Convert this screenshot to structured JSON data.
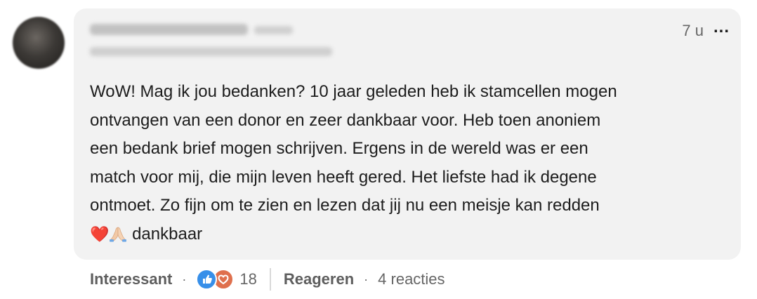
{
  "comment": {
    "time": "7 u",
    "more_label": "...",
    "text_lines": [
      "WoW! Mag ik jou bedanken? 10 jaar geleden heb ik stamcellen mogen",
      "ontvangen van een donor en zeer dankbaar voor. Heb toen anoniem",
      "een bedank brief mogen schrijven. Ergens in de wereld was er een",
      "match voor mij, die mijn leven heeft gered. Het liefste had ik degene",
      "ontmoet. Zo fijn om te zien en lezen dat jij nu een meisje kan redden"
    ],
    "last_line": {
      "emoji_heart": "❤️",
      "emoji_pray": "folded-hands-icon",
      "text": "dankbaar"
    }
  },
  "actions": {
    "react_label": "Interessant",
    "reaction_icons": [
      "like-icon",
      "love-icon"
    ],
    "reaction_count": "18",
    "reply_label": "Reageren",
    "replies_count": "4 reacties"
  },
  "colors": {
    "bubble": "#f2f2f2",
    "text": "#1d1d1d",
    "muted": "#666666",
    "like": "#378fe9",
    "love": "#df704d"
  }
}
